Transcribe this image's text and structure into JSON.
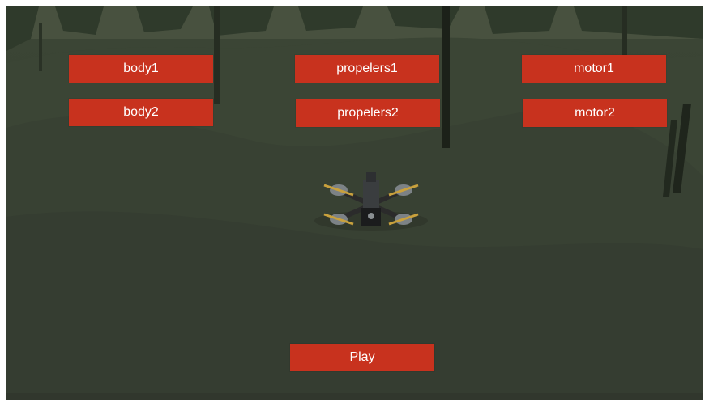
{
  "scene": {
    "name": "forest-hillside",
    "accent_color": "#c8321e"
  },
  "parts_menu": {
    "body1": "body1",
    "body2": "body2",
    "propelers1": "propelers1",
    "propelers2": "propelers2",
    "motor1": "motor1",
    "motor2": "motor2"
  },
  "play_label": "Play"
}
